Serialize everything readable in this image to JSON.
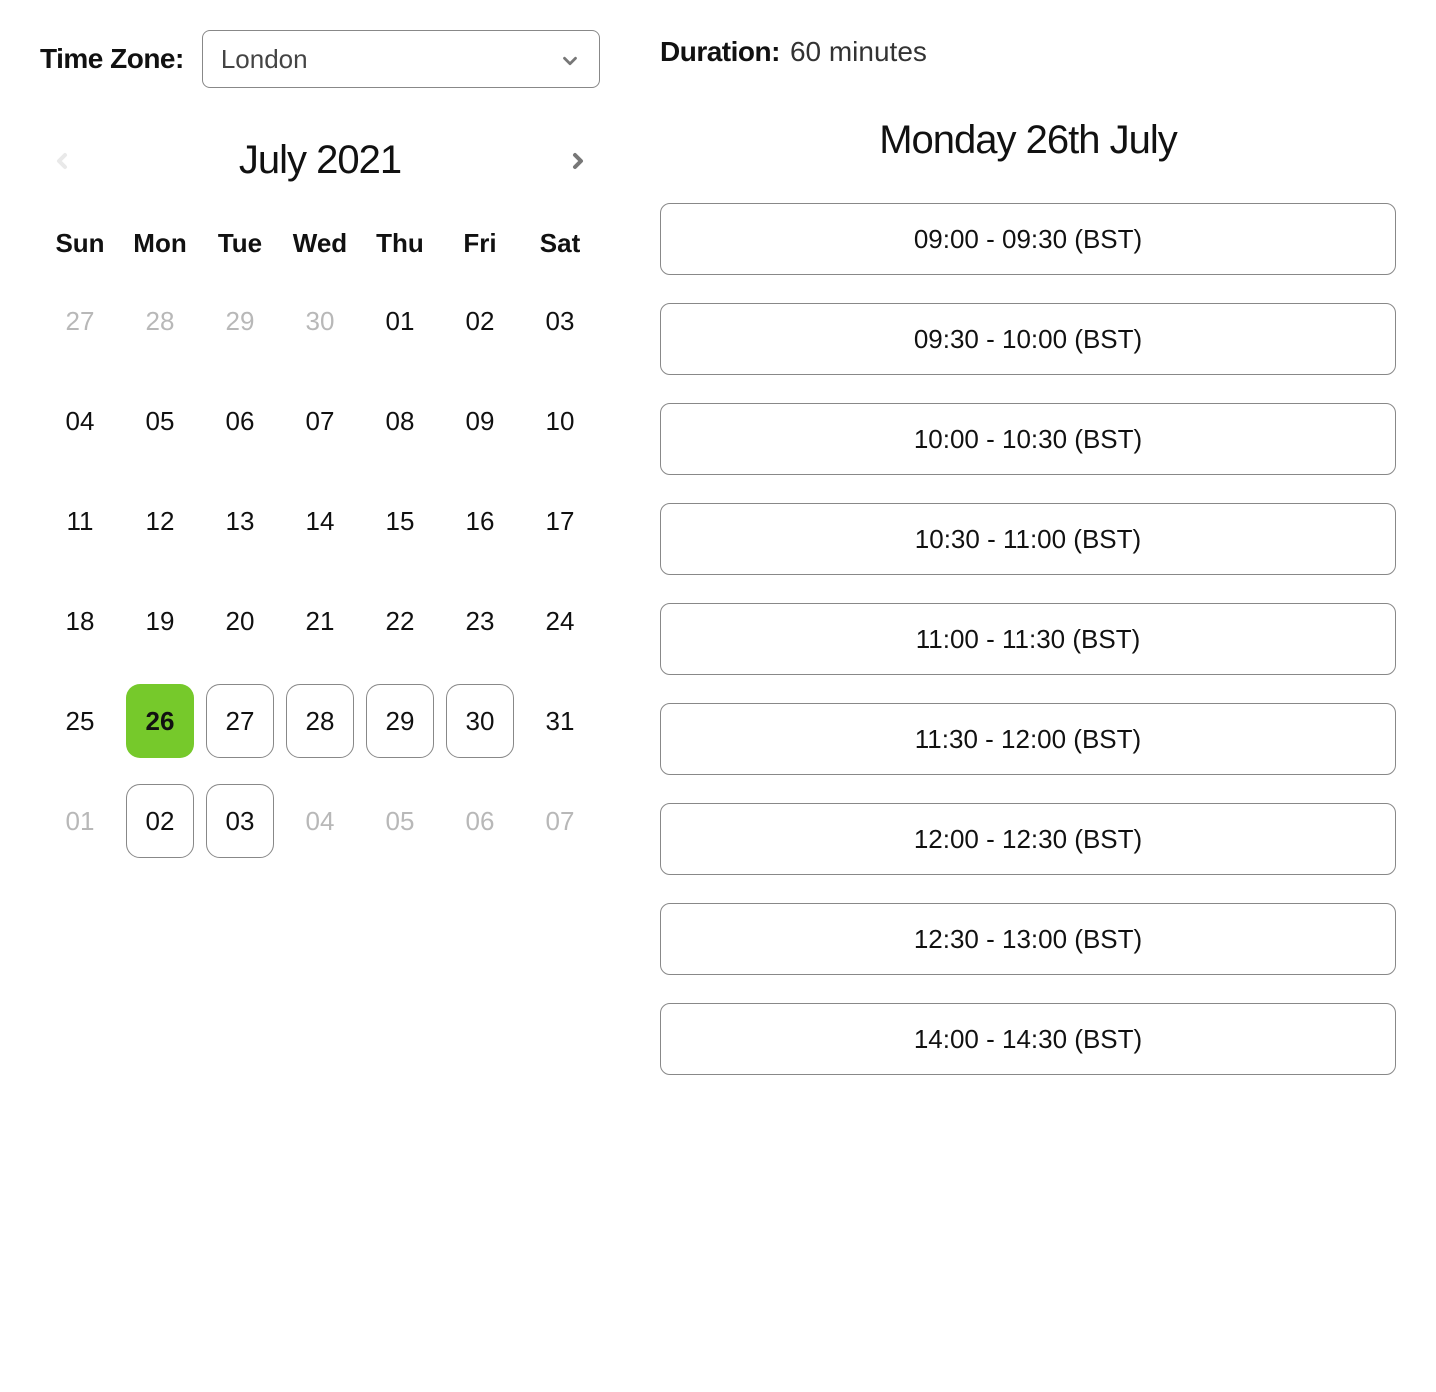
{
  "timezone": {
    "label": "Time Zone:",
    "value": "London"
  },
  "duration": {
    "label": "Duration:",
    "value": "60 minutes"
  },
  "month_label": "July 2021",
  "selected_date_label": "Monday 26th July",
  "weekdays": [
    "Sun",
    "Mon",
    "Tue",
    "Wed",
    "Thu",
    "Fri",
    "Sat"
  ],
  "days": [
    {
      "n": "27",
      "state": "other"
    },
    {
      "n": "28",
      "state": "other"
    },
    {
      "n": "29",
      "state": "other"
    },
    {
      "n": "30",
      "state": "other"
    },
    {
      "n": "01",
      "state": "current"
    },
    {
      "n": "02",
      "state": "current"
    },
    {
      "n": "03",
      "state": "current"
    },
    {
      "n": "04",
      "state": "current"
    },
    {
      "n": "05",
      "state": "current"
    },
    {
      "n": "06",
      "state": "current"
    },
    {
      "n": "07",
      "state": "current"
    },
    {
      "n": "08",
      "state": "current"
    },
    {
      "n": "09",
      "state": "current"
    },
    {
      "n": "10",
      "state": "current"
    },
    {
      "n": "11",
      "state": "current"
    },
    {
      "n": "12",
      "state": "current"
    },
    {
      "n": "13",
      "state": "current"
    },
    {
      "n": "14",
      "state": "current"
    },
    {
      "n": "15",
      "state": "current"
    },
    {
      "n": "16",
      "state": "current"
    },
    {
      "n": "17",
      "state": "current"
    },
    {
      "n": "18",
      "state": "current"
    },
    {
      "n": "19",
      "state": "current"
    },
    {
      "n": "20",
      "state": "current"
    },
    {
      "n": "21",
      "state": "current"
    },
    {
      "n": "22",
      "state": "current"
    },
    {
      "n": "23",
      "state": "current"
    },
    {
      "n": "24",
      "state": "current"
    },
    {
      "n": "25",
      "state": "current"
    },
    {
      "n": "26",
      "state": "selected"
    },
    {
      "n": "27",
      "state": "available"
    },
    {
      "n": "28",
      "state": "available"
    },
    {
      "n": "29",
      "state": "available"
    },
    {
      "n": "30",
      "state": "available"
    },
    {
      "n": "31",
      "state": "current"
    },
    {
      "n": "01",
      "state": "other"
    },
    {
      "n": "02",
      "state": "available"
    },
    {
      "n": "03",
      "state": "available"
    },
    {
      "n": "04",
      "state": "other"
    },
    {
      "n": "05",
      "state": "other"
    },
    {
      "n": "06",
      "state": "other"
    },
    {
      "n": "07",
      "state": "other"
    }
  ],
  "slots": [
    "09:00 - 09:30 (BST)",
    "09:30 - 10:00 (BST)",
    "10:00 - 10:30 (BST)",
    "10:30 - 11:00 (BST)",
    "11:00 - 11:30 (BST)",
    "11:30 - 12:00 (BST)",
    "12:00 - 12:30 (BST)",
    "12:30 - 13:00 (BST)",
    "14:00 - 14:30 (BST)"
  ]
}
